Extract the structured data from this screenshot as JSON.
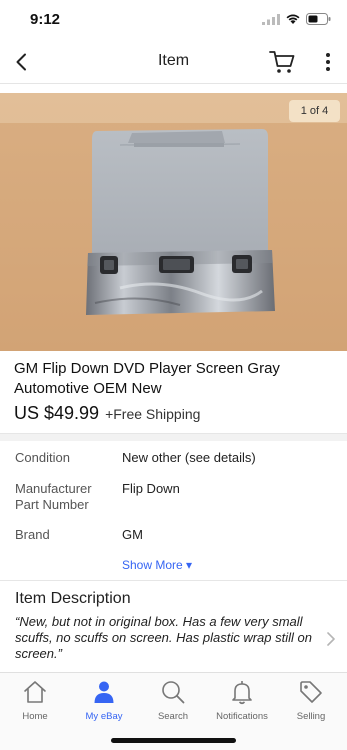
{
  "status": {
    "time": "9:12"
  },
  "nav": {
    "title": "Item"
  },
  "gallery": {
    "counter": "1 of 4"
  },
  "listing": {
    "title": "GM Flip Down DVD Player Screen Gray Automotive OEM New",
    "price": "US $49.99",
    "shipping": "+Free Shipping"
  },
  "specifics": [
    {
      "label": "Condition",
      "value": "New other (see details)"
    },
    {
      "label": "Manufacturer Part Number",
      "value": "Flip Down"
    },
    {
      "label": "Brand",
      "value": "GM"
    }
  ],
  "show_more": "Show More ▾",
  "description": {
    "heading": "Item Description",
    "text": "“New, but not in original box.  Has a few very small scuffs, no scuffs on screen.  Has plastic wrap still on screen.”"
  },
  "tabs": [
    {
      "label": "Home",
      "icon": "home-icon"
    },
    {
      "label": "My eBay",
      "icon": "person-icon",
      "active": true
    },
    {
      "label": "Search",
      "icon": "search-icon"
    },
    {
      "label": "Notifications",
      "icon": "bell-icon"
    },
    {
      "label": "Selling",
      "icon": "tag-icon"
    }
  ],
  "colors": {
    "accent": "#3665f3",
    "hero_bg": "#d8ad80"
  }
}
